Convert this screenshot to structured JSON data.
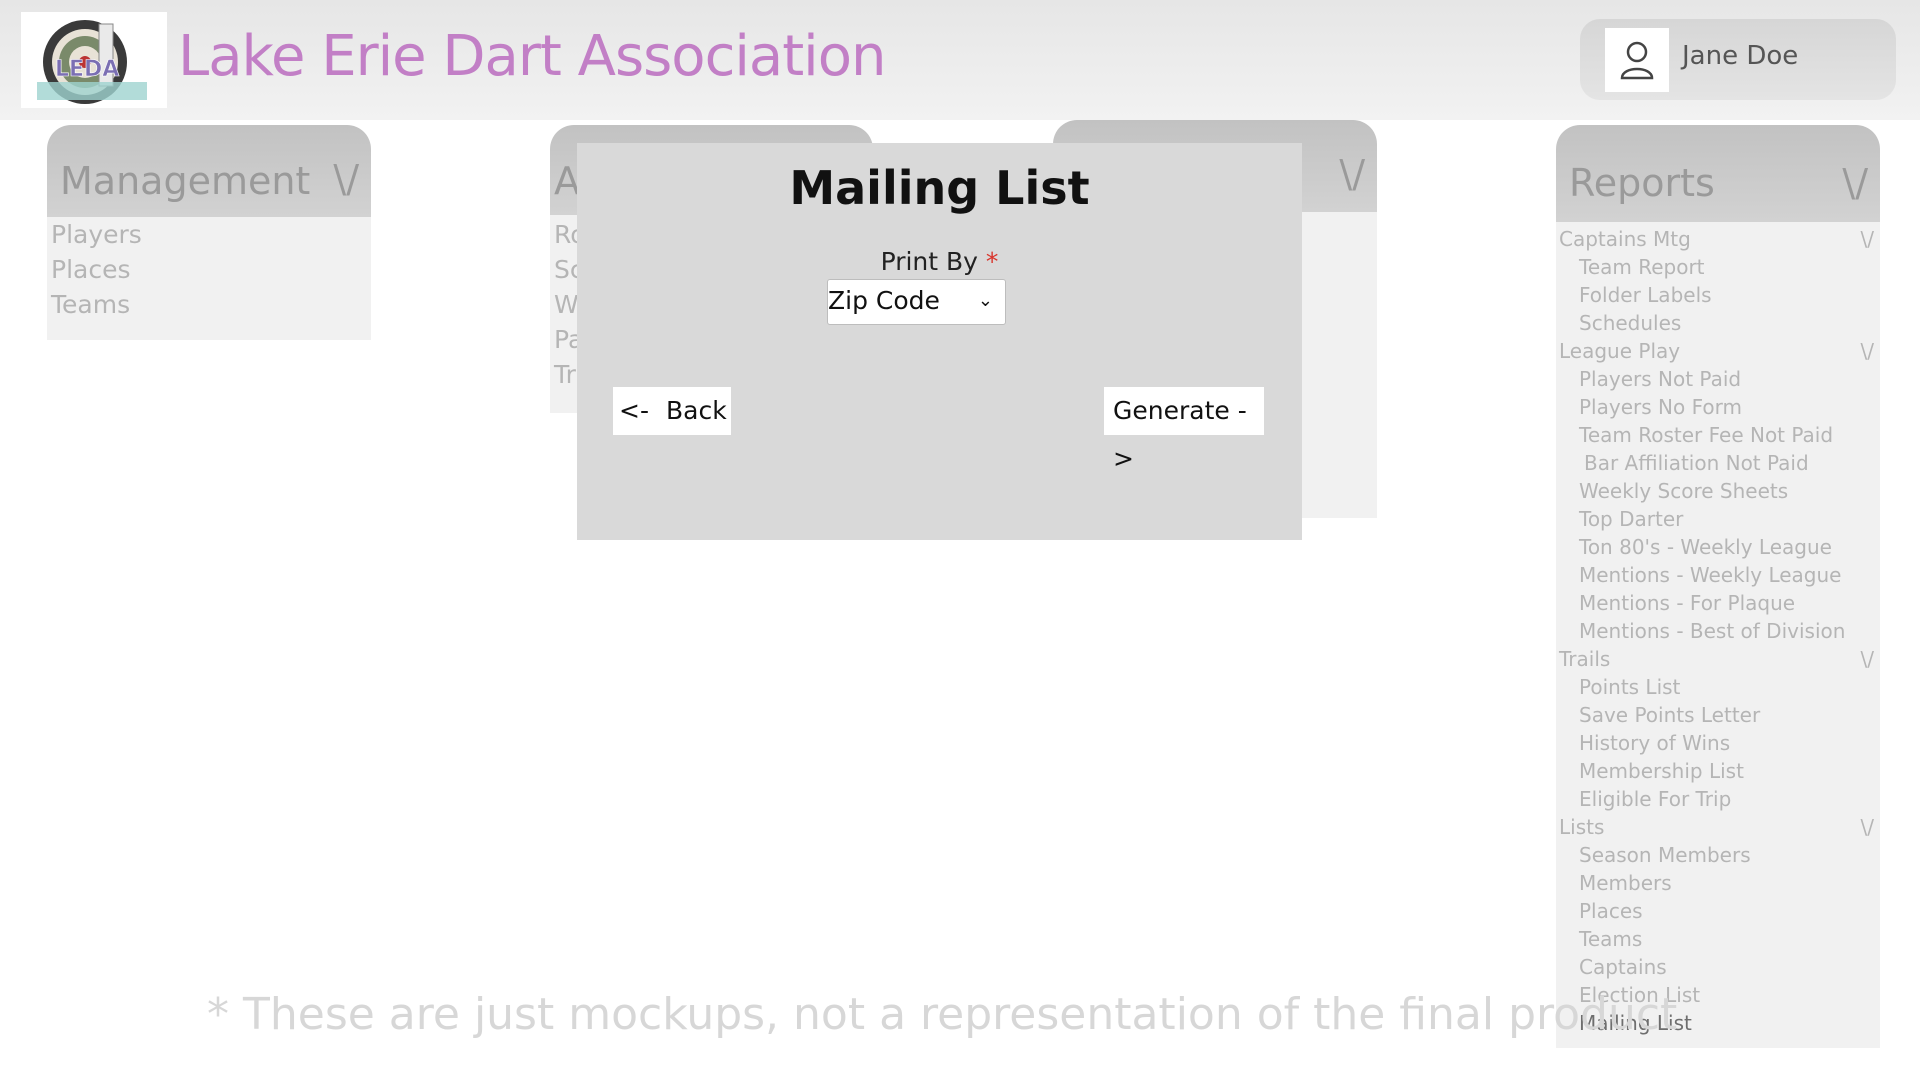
{
  "header": {
    "app_title": "Lake Erie Dart Association",
    "logo_text": "LEDA",
    "user_name": "Jane Doe"
  },
  "panels": {
    "management": {
      "title": "Management",
      "items": [
        "Players",
        "Places",
        "Teams"
      ]
    },
    "admin": {
      "title_visible": "A",
      "items_visible": [
        "Ro",
        "Sc",
        "W",
        "Pa",
        "Tr"
      ]
    },
    "reports": {
      "title": "Reports",
      "groups": [
        {
          "label": "Captains Mtg",
          "items": [
            "Team Report",
            "Folder Labels",
            "Schedules"
          ]
        },
        {
          "label": "League Play",
          "items": [
            "Players Not Paid",
            "Players No Form",
            "Team Roster Fee Not Paid",
            "Bar Affiliation Not Paid",
            "Weekly Score Sheets",
            "Top Darter",
            "Ton 80's - Weekly League",
            "Mentions - Weekly League",
            "Mentions - For Plaque",
            "Mentions - Best of Division"
          ]
        },
        {
          "label": "Trails",
          "items": [
            "Points List",
            "Save Points Letter",
            "History of Wins",
            "Membership List",
            "Eligible For Trip"
          ]
        },
        {
          "label": "Lists",
          "items": [
            "Season Members",
            "Members",
            "Places",
            "Teams",
            "Captains",
            "Election List",
            "Mailing List"
          ]
        }
      ]
    }
  },
  "chevron_glyph": "\\/",
  "modal": {
    "title": "Mailing List",
    "field_label": "Print By",
    "required_marker": "*",
    "select_value": "Zip Code",
    "back_arrow": "<-",
    "back_label": "Back",
    "generate_label": "Generate ->"
  },
  "disclaimer": "*  These are just mockups, not a representation of the final product",
  "colors": {
    "brand": "#c27fc6",
    "required": "#d9342b",
    "modal_bg": "#d9d9d9"
  }
}
